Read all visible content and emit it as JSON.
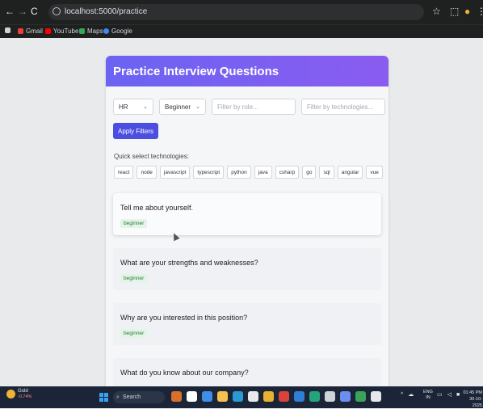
{
  "browser": {
    "nav": {
      "back": "←",
      "forward": "→",
      "reload": "C"
    },
    "url": "localhost:5000/practice",
    "icons": {
      "star": "☆",
      "extensions": "⬚",
      "profile": "●",
      "menu": "⋮"
    },
    "bookmarks": [
      {
        "icon": "apps-grid-icon",
        "label": "",
        "color": "#cfd2d6"
      },
      {
        "icon": "gmail-icon",
        "label": "Gmail",
        "color": "#ea4335"
      },
      {
        "icon": "youtube-icon",
        "label": "YouTube",
        "color": "#ff0000"
      },
      {
        "icon": "maps-icon",
        "label": "Maps",
        "color": "#34a853"
      },
      {
        "icon": "google-icon",
        "label": "Google",
        "color": "#4285f4"
      }
    ]
  },
  "page": {
    "title": "Practice Interview Questions",
    "header_gradient": [
      "#6b63f3",
      "#8a5cf0"
    ],
    "filters": {
      "category": "HR",
      "level": "Beginner",
      "role_placeholder": "Filter by role...",
      "tech_placeholder": "Filter by technologies..."
    },
    "apply_label": "Apply Filters",
    "quick_label": "Quick select technologies:",
    "technologies": [
      "react",
      "node",
      "javascript",
      "typescript",
      "python",
      "java",
      "csharp",
      "go",
      "sql",
      "angular",
      "vue"
    ],
    "questions": [
      {
        "text": "Tell me about yourself.",
        "level": "beginner"
      },
      {
        "text": "What are your strengths and weaknesses?",
        "level": "beginner"
      },
      {
        "text": "Why are you interested in this position?",
        "level": "beginner"
      },
      {
        "text": "What do you know about our company?",
        "level": ""
      }
    ]
  },
  "taskbar": {
    "weather_title": "Gold",
    "weather_sub": "-0.74%",
    "search_label": "Search",
    "language": "ENG",
    "region": "IN",
    "time": "01:45 PM",
    "date": "30-10-2025"
  }
}
